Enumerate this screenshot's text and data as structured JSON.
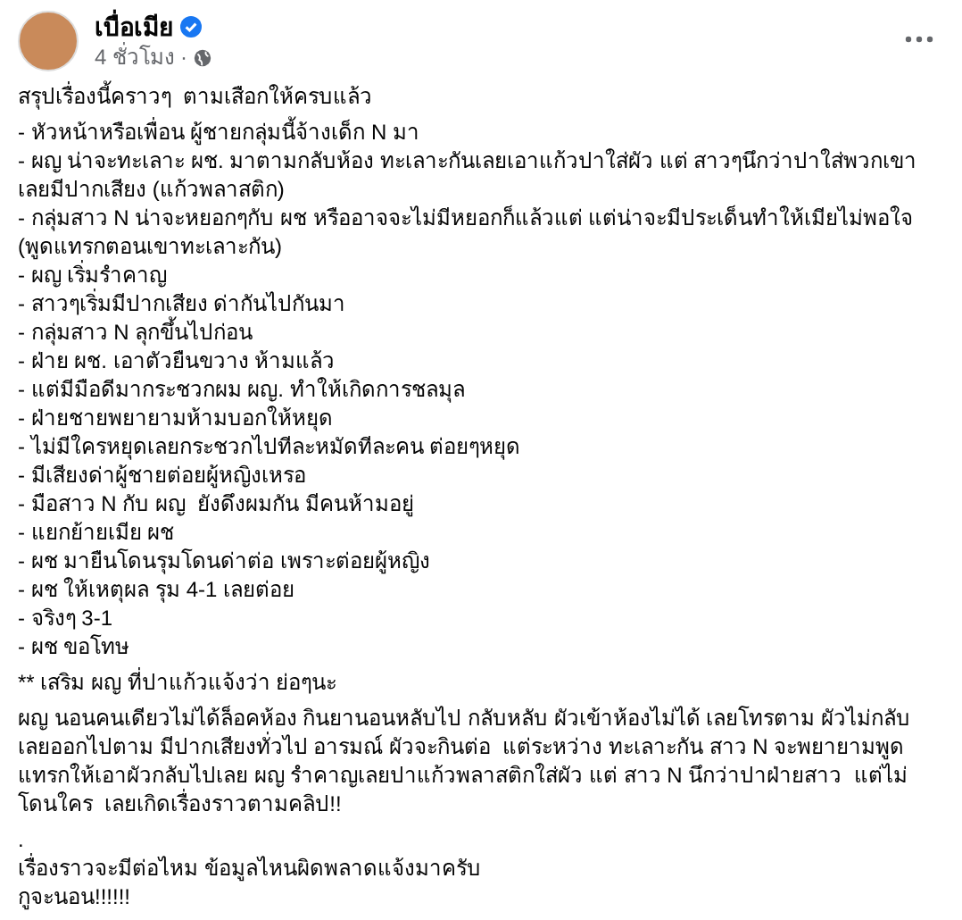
{
  "post": {
    "author": {
      "name": "เบื่อเมีย",
      "verified": true
    },
    "time": "4 ชั่วโมง",
    "separator": "·",
    "intro": "สรุปเรื่องนี้คราวๆ  ตามเสือกให้ครบแล้ว",
    "items": [
      "- หัวหน้าหรือเพื่อน ผู้ชายกลุ่มนี้จ้างเด็ก N มา",
      "- ผญ น่าจะทะเลาะ ผช. มาตามกลับห้อง ทะเลาะกันเลยเอาแก้วปาใส่ผัว แต่ สาวๆนึกว่าปาใส่พวกเขาเลยมีปากเสียง (แก้วพลาสติก)",
      "- กลุ่มสาว N น่าจะหยอกๆกับ ผช หรืออาจจะไม่มีหยอกก็แล้วแต่ แต่น่าจะมีประเด็นทำให้เมียไม่พอใจ (พูดแทรกตอนเขาทะเลาะกัน)",
      "- ผญ เริ่มรำคาญ",
      "- สาวๆเริ่มมีปากเสียง ด่ากันไปกันมา",
      "- กลุ่มสาว N ลุกขึ้นไปก่อน",
      "- ฝ่าย ผช. เอาตัวยืนขวาง ห้ามแล้ว",
      "- แต่มีมือดีมากระชวกผม ผญ. ทำให้เกิดการชลมุล",
      "- ฝ่ายชายพยายามห้ามบอกให้หยุด",
      "- ไม่มีใครหยุดเลยกระชวกไปทีละหมัดทีละคน ต่อยๆหยุด",
      "- มีเสียงด่าผู้ชายต่อยผู้หญิงเหรอ",
      "- มือสาว N กับ ผญ  ยังดึงผมกัน มีคนห้ามอยู่",
      "- แยกย้ายเมีย ผช",
      "- ผช มายืนโดนรุมโดนด่าต่อ เพราะต่อยผู้หญิง",
      "- ผช ให้เหตุผล รุม 4-1 เลยต่อย",
      "- จริงๆ 3-1",
      "- ผช ขอโทษ"
    ],
    "note": "** เสริม ผญ ที่ปาแก้วแจ้งว่า ย่อๆนะ",
    "paragraph": "ผญ นอนคนเดียวไม่ได้ล็อคห้อง กินยานอนหลับไป กลับหลับ ผัวเข้าห้องไม่ได้ เลยโทรตาม ผัวไม่กลับ เลยออกไปตาม มีปากเสียงทั่วไป อารมณ์ ผัวจะกินต่อ  แต่ระหว่าง ทะเลาะกัน สาว N จะพยายามพูดแทรกให้เอาผัวกลับไปเลย ผญ รำคาญเลยปาแก้วพลาสติกใส่ผัว แต่ สาว N นึกว่าปาฝ่ายสาว  แต่ไม่โดนใคร  เลยเกิดเรื่องราวตามคลิป!!",
    "dot": ".",
    "closing": [
      "เรื่องราวจะมีต่อไหม ข้อมูลไหนผิดพลาดแจ้งมาครับ",
      "กูจะนอน!!!!!!"
    ]
  }
}
